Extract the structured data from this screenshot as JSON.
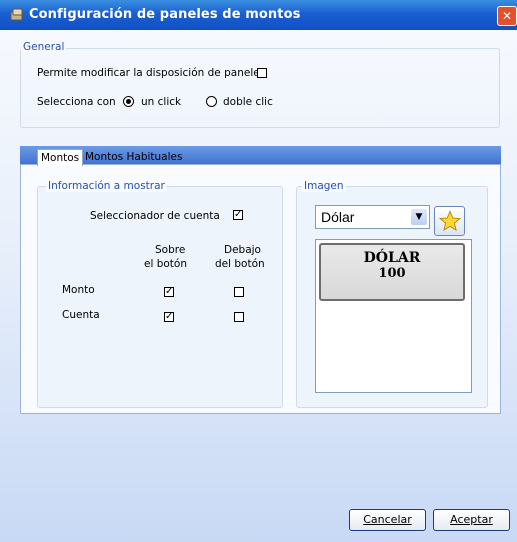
{
  "window": {
    "title": "Configuración de paneles de montos",
    "close_glyph": "✕"
  },
  "general": {
    "group_label": "General",
    "allow_modify_label": "Permite modificar la disposición de paneles",
    "allow_modify_checked": false,
    "select_with_label": "Selecciona con",
    "radio_single_label": "un click",
    "radio_double_label": "doble clic",
    "selected_option": "un click"
  },
  "tabs": [
    {
      "label": "Montos",
      "active": true
    },
    {
      "label": "Montos Habituales",
      "active": false
    }
  ],
  "info_group": {
    "label": "Información a mostrar",
    "account_selector_label": "Seleccionador de cuenta",
    "account_selector_checked": true,
    "col_over_line1": "Sobre",
    "col_over_line2": "el botón",
    "col_below_line1": "Debajo",
    "col_below_line2": "del botón",
    "rows": [
      {
        "label": "Monto",
        "over": true,
        "below": false
      },
      {
        "label": "Cuenta",
        "over": true,
        "below": false
      }
    ]
  },
  "image_group": {
    "label": "Imagen",
    "currency_value": "Dólar",
    "star_icon": "star-icon",
    "preview_line1": "DÓLAR",
    "preview_line2": "100"
  },
  "footer": {
    "cancel_label": "Cancelar",
    "accept_label": "Aceptar"
  },
  "colors": {
    "titlebar": "#1a5fd0",
    "group_label": "#2a4fb0",
    "close_button": "#e0512c"
  }
}
